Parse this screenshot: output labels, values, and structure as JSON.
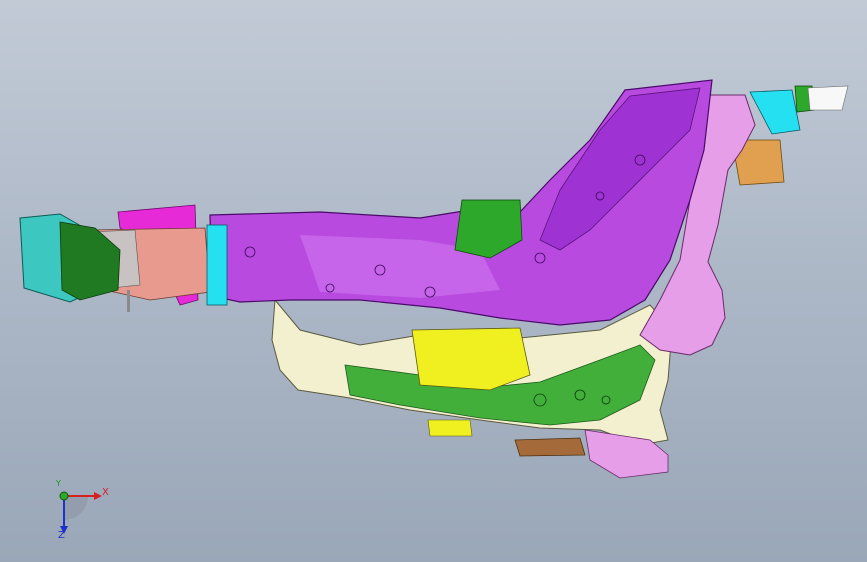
{
  "viewport": {
    "background_top": "#c2cad6",
    "background_bottom": "#9aa7b8"
  },
  "model": {
    "description_colors": {
      "rail_purple": "#b84ae0",
      "rail_purple_dark": "#7a22b8",
      "pink": "#e69ee8",
      "cream": "#f3f0cf",
      "green": "#2ea82a",
      "dark_green": "#1f7a22",
      "yellow": "#f0ef20",
      "teal": "#3cc8c0",
      "cyan": "#24e0f0",
      "salmon": "#e89a8e",
      "orange": "#e0a050",
      "brown": "#a56a3a",
      "magenta": "#e62ad8"
    }
  },
  "triad": {
    "x_label": "X",
    "y_label": "Y",
    "z_label": "Z",
    "x_color": "#d42020",
    "y_color": "#1a9a1a",
    "z_color": "#2030c8"
  }
}
